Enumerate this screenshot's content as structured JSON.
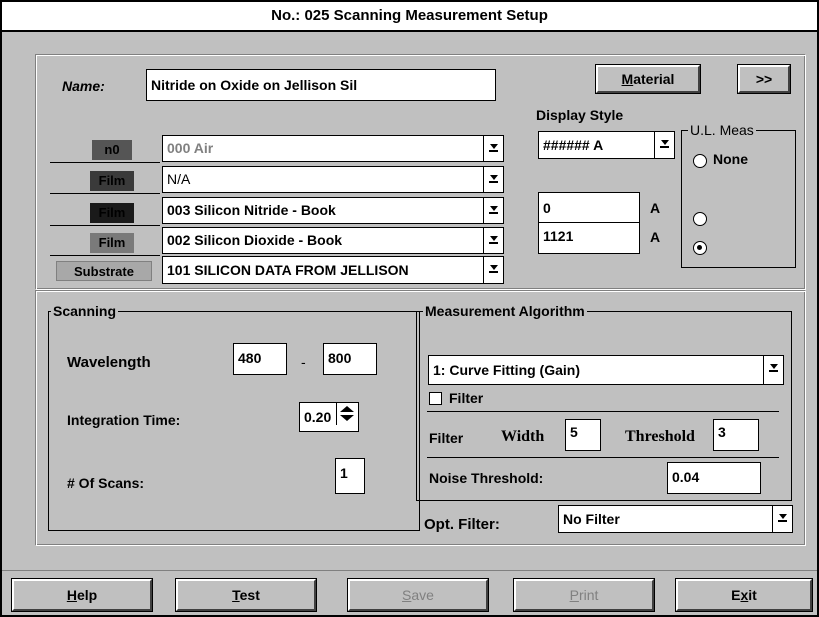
{
  "window": {
    "title": "No.: 025 Scanning Measurement Setup"
  },
  "header": {
    "name_label": "Name:",
    "name_value": "Nitride on Oxide on Jellison Sil",
    "material_button": {
      "pre": "",
      "ul": "M",
      "post": "aterial"
    },
    "more_button": ">>",
    "display_style_label": "Display Style",
    "display_style_value": "###### A"
  },
  "layers": [
    {
      "tag": "n0",
      "value": "000  Air",
      "grey": true
    },
    {
      "tag": "Film",
      "value": "N/A",
      "grey": false
    },
    {
      "tag": "Film",
      "value": "003  Silicon Nitride - Book",
      "grey": false
    },
    {
      "tag": "Film",
      "value": "002  Silicon Dioxide - Book",
      "grey": false
    },
    {
      "tag": "Substrate",
      "value": "101  SILICON DATA FROM JELLISON",
      "grey": false
    }
  ],
  "thickness": [
    {
      "value": "0",
      "unit": "A"
    },
    {
      "value": "1121",
      "unit": "A"
    }
  ],
  "ul_meas": {
    "label": "U.L. Meas",
    "none_label": "None"
  },
  "scanning": {
    "label": "Scanning",
    "wavelength_label": "Wavelength",
    "wavelength_from": "480",
    "dash": "-",
    "wavelength_to": "800",
    "integration_label": "Integration Time:",
    "integration_value": "0.20",
    "scans_label": "# Of Scans:",
    "scans_value": "1"
  },
  "algorithm": {
    "label": "Measurement Algorithm",
    "value": "1: Curve Fitting (Gain)",
    "filter_checkbox_label": "Filter",
    "filter_label": "Filter",
    "width_label": "Width",
    "width_value": "5",
    "threshold_label": "Threshold",
    "threshold_value": "3",
    "noise_label": "Noise Threshold:",
    "noise_value": "0.04",
    "opt_filter_label": "Opt. Filter:",
    "opt_filter_value": "No Filter"
  },
  "buttons": {
    "help": {
      "ul": "H",
      "post": "elp"
    },
    "test": {
      "ul": "T",
      "post": "est"
    },
    "save": {
      "ul": "S",
      "post": "ave"
    },
    "print": {
      "ul": "P",
      "post": "rint"
    },
    "exit": {
      "pre": "E",
      "ul": "x",
      "post": "it"
    }
  }
}
